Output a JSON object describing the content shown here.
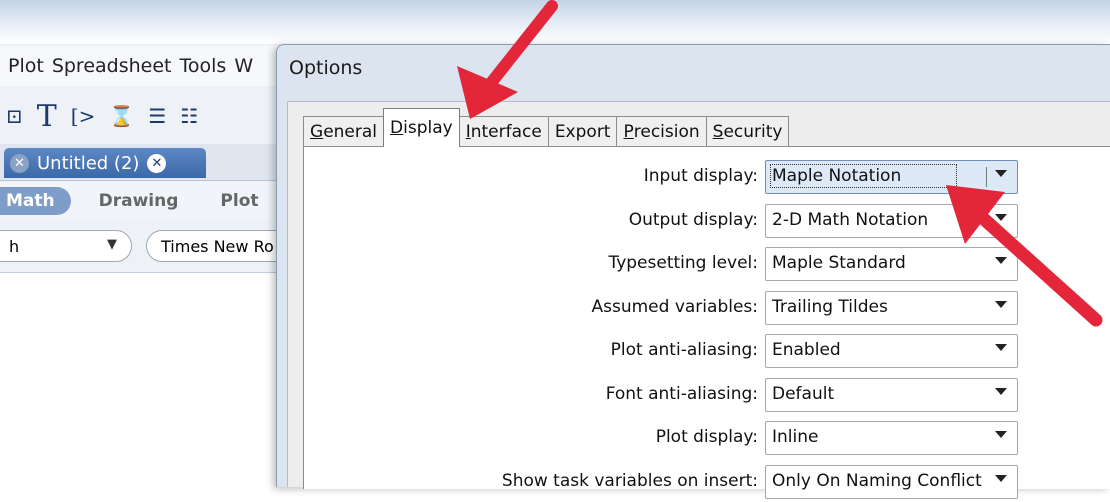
{
  "background_window": {
    "menu": [
      "Plot",
      "Spreadsheet",
      "Tools",
      "W"
    ],
    "toolbar_glyphs": [
      "⊡",
      "T",
      "[>",
      "⌛",
      "☰",
      "☷"
    ],
    "doc_tab": {
      "label": "Untitled (2)"
    },
    "modes": {
      "math": "Math",
      "drawing": "Drawing",
      "plot": "Plot"
    },
    "style_select": {
      "value": "h"
    },
    "font_select": {
      "value": "Times New Ro"
    }
  },
  "dialog": {
    "title": "Options",
    "tabs": [
      {
        "pre": "",
        "mn": "G",
        "post": "eneral",
        "active": false
      },
      {
        "pre": "",
        "mn": "D",
        "post": "isplay",
        "active": true
      },
      {
        "pre": "",
        "mn": "I",
        "post": "nterface",
        "active": false
      },
      {
        "pre": "Ex",
        "mn": "",
        "post": "port",
        "active": false
      },
      {
        "pre": "",
        "mn": "P",
        "post": "recision",
        "active": false
      },
      {
        "pre": "",
        "mn": "S",
        "post": "ecurity",
        "active": false
      }
    ],
    "rows": [
      {
        "label": "Input display:",
        "value": "Maple Notation",
        "focused": true
      },
      {
        "label": "Output display:",
        "value": "2-D Math Notation",
        "focused": false
      },
      {
        "label": "Typesetting level:",
        "value": "Maple Standard",
        "focused": false
      },
      {
        "label": "Assumed variables:",
        "value": "Trailing Tildes",
        "focused": false
      },
      {
        "label": "Plot anti-aliasing:",
        "value": "Enabled",
        "focused": false
      },
      {
        "label": "Font anti-aliasing:",
        "value": "Default",
        "focused": false
      },
      {
        "label": "Plot display:",
        "value": "Inline",
        "focused": false
      },
      {
        "label": "Show task variables on insert:",
        "value": "Only On Naming Conflict",
        "focused": false
      }
    ]
  },
  "colors": {
    "annotation_arrow": "#e3263a",
    "dialog_frame": "#dbe4ef",
    "focus_fill": "#dde9f7"
  }
}
